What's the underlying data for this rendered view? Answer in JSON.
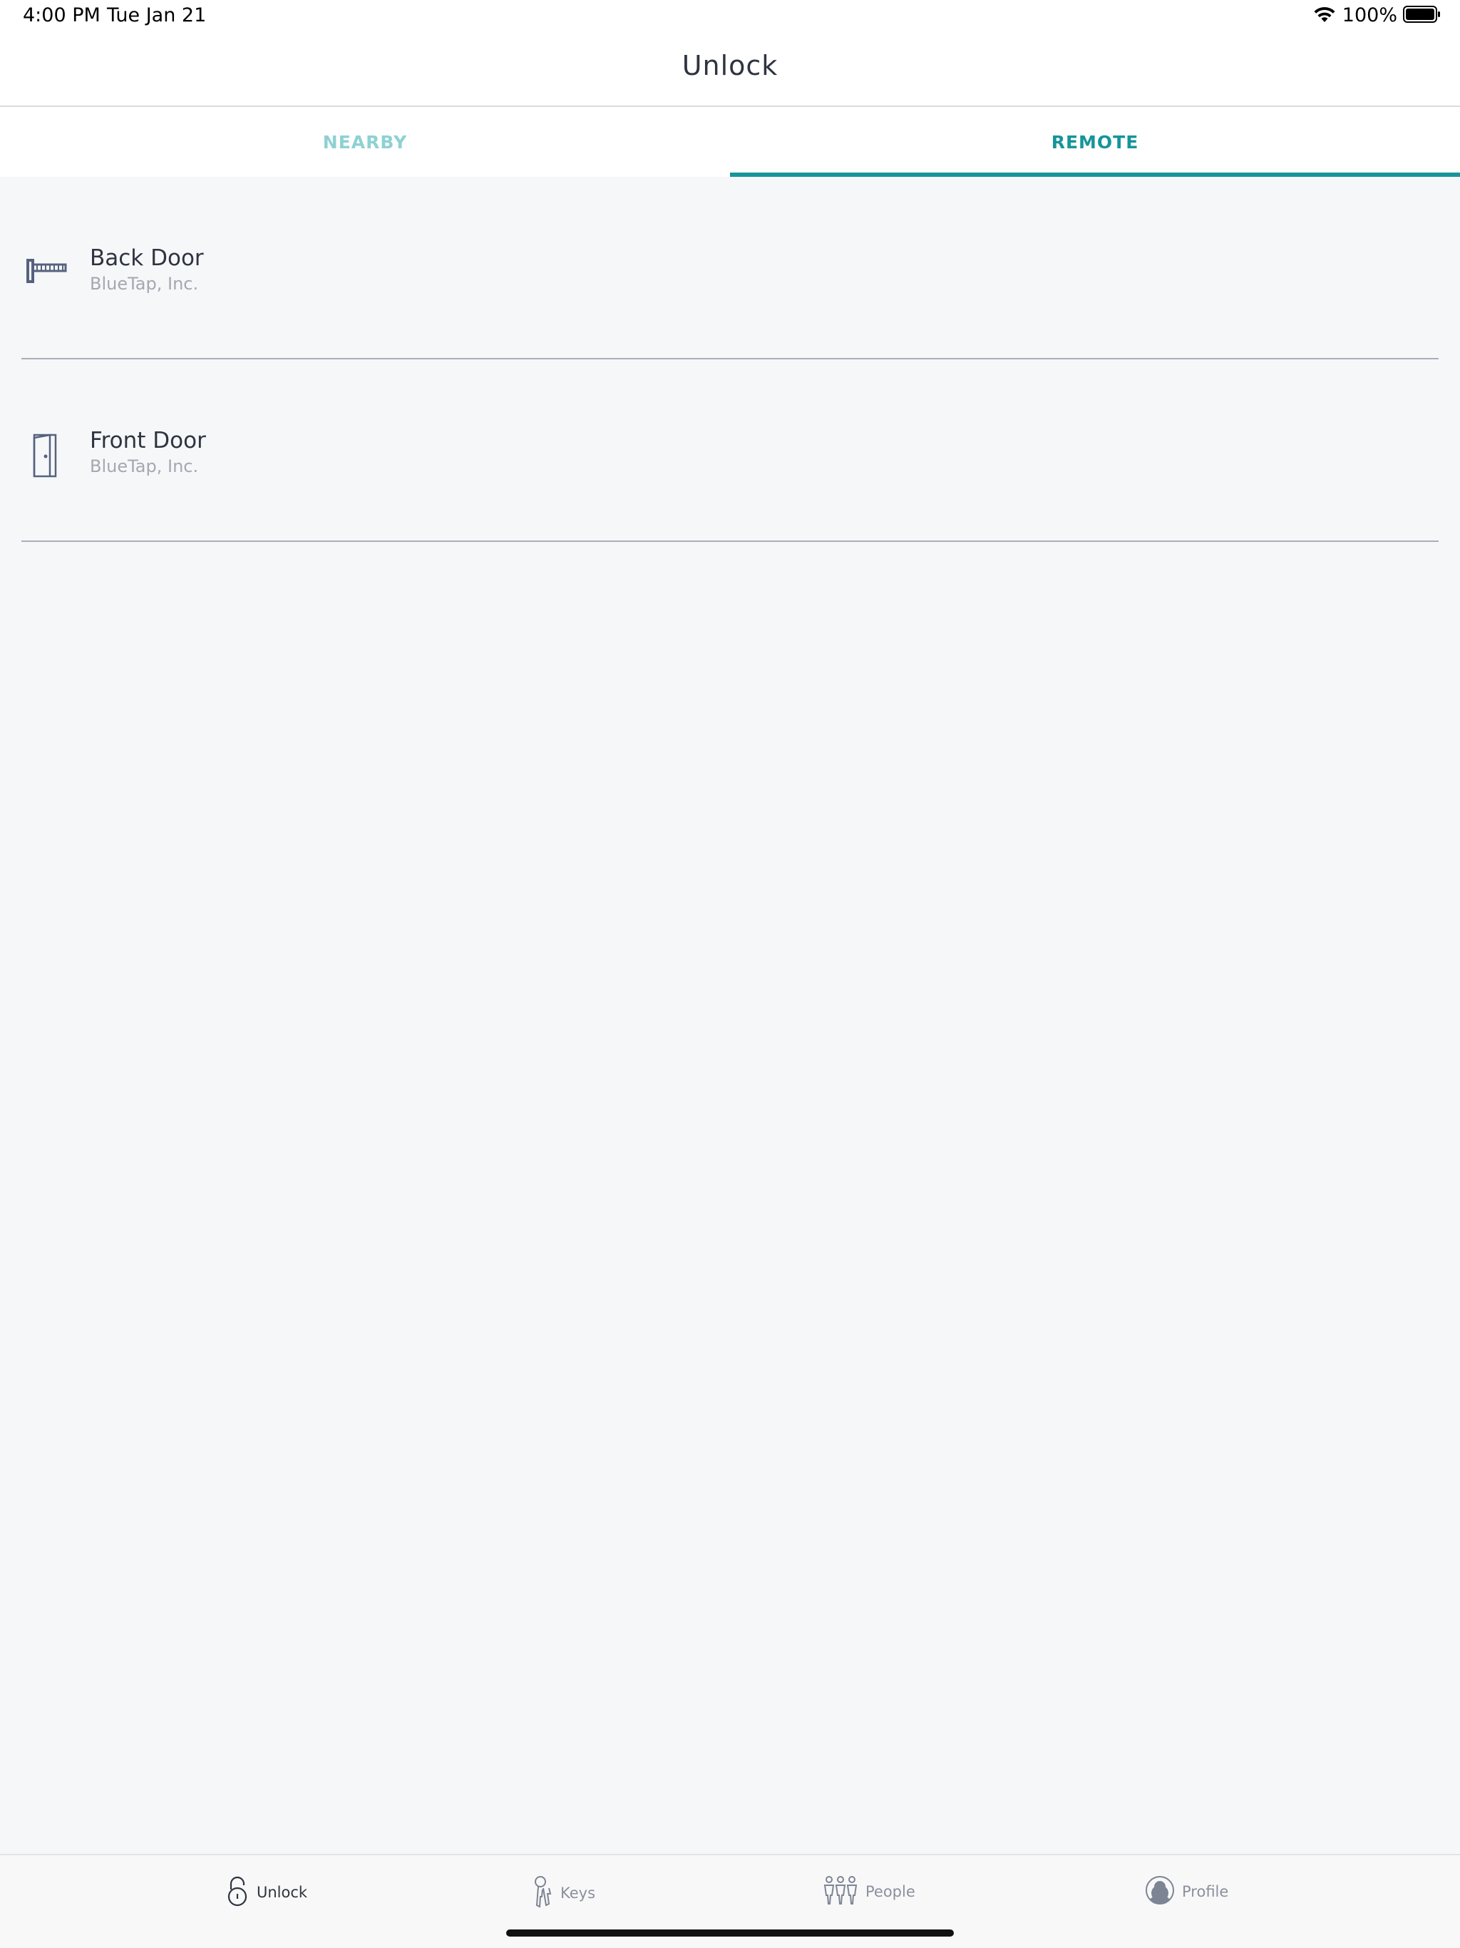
{
  "status_bar": {
    "time": "4:00 PM",
    "date": "Tue Jan 21",
    "battery": "100%"
  },
  "header": {
    "title": "Unlock"
  },
  "tabs": [
    {
      "label": "NEARBY",
      "active": false
    },
    {
      "label": "REMOTE",
      "active": true
    }
  ],
  "doors": [
    {
      "name": "Back Door",
      "organization": "BlueTap, Inc.",
      "icon": "gate-barrier-icon"
    },
    {
      "name": "Front Door",
      "organization": "BlueTap, Inc.",
      "icon": "door-icon"
    }
  ],
  "tab_bar": {
    "items": [
      {
        "label": "Unlock",
        "icon": "padlock-icon",
        "selected": true
      },
      {
        "label": "Keys",
        "icon": "key-icon",
        "selected": false
      },
      {
        "label": "People",
        "icon": "people-icon",
        "selected": false
      },
      {
        "label": "Profile",
        "icon": "profile-icon",
        "selected": false
      }
    ]
  },
  "colors": {
    "accent": "#16959a",
    "accent_light": "#8ed1d3",
    "background": "#f6f7f9",
    "text_primary": "#2e3440",
    "text_secondary": "#a4a8b0",
    "icon_blue": "#56627e"
  }
}
